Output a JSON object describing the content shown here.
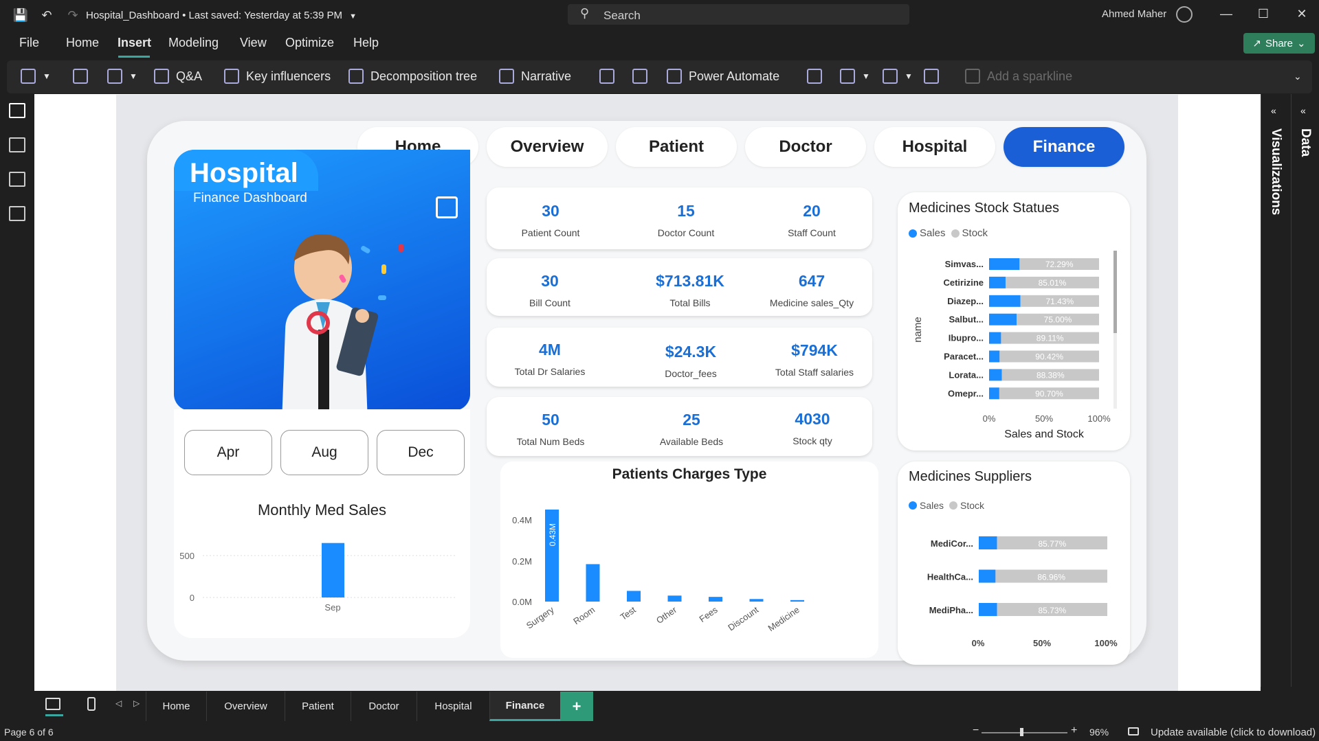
{
  "titlebar": {
    "file_name": "Hospital_Dashboard",
    "saved": "Last saved: Yesterday at 5:39 PM",
    "search_placeholder": "Search",
    "user": "Ahmed Maher"
  },
  "menu": {
    "items": [
      "File",
      "Home",
      "Insert",
      "Modeling",
      "View",
      "Optimize",
      "Help"
    ],
    "active": "Insert",
    "share_label": "Share"
  },
  "ribbon": {
    "qa": "Q&A",
    "key_influencers": "Key influencers",
    "decomposition_tree": "Decomposition tree",
    "narrative": "Narrative",
    "power_automate": "Power Automate",
    "add_sparkline": "Add a sparkline"
  },
  "panes": {
    "visualizations": "Visualizations",
    "data": "Data"
  },
  "dashboard": {
    "nav": [
      "Home",
      "Overview",
      "Patient",
      "Doctor",
      "Hospital",
      "Finance"
    ],
    "nav_active": "Finance",
    "hero_title": "Hospital",
    "hero_subtitle": "Finance Dashboard",
    "months": [
      "Apr",
      "Aug",
      "Dec"
    ],
    "kpis": [
      {
        "value": "30",
        "label": "Patient Count"
      },
      {
        "value": "15",
        "label": "Doctor Count"
      },
      {
        "value": "20",
        "label": "Staff Count"
      },
      {
        "value": "30",
        "label": "Bill Count"
      },
      {
        "value": "$713.81K",
        "label": "Total Bills"
      },
      {
        "value": "647",
        "label": "Medicine sales_Qty"
      },
      {
        "value": "4M",
        "label": "Total Dr Salaries"
      },
      {
        "value": "$24.3K",
        "label": "Doctor_fees"
      },
      {
        "value": "$794K",
        "label": "Total Staff salaries"
      },
      {
        "value": "50",
        "label": "Total Num Beds"
      },
      {
        "value": "25",
        "label": "Available Beds"
      },
      {
        "value": "4030",
        "label": "Stock qty"
      }
    ]
  },
  "colors": {
    "accent": "#1a8cff",
    "nav_active": "#1a5fd6",
    "stock": "#c8c8c8",
    "kpi_value": "#1a6fd6"
  },
  "chart_data": [
    {
      "type": "bar",
      "title": "Monthly Med Sales",
      "categories": [
        "Sep"
      ],
      "values": [
        650
      ],
      "yticks": [
        "0",
        "500"
      ],
      "ylim": [
        0,
        700
      ]
    },
    {
      "type": "bar",
      "title": "Patients Charges Type",
      "categories": [
        "Surgery",
        "Room",
        "Test",
        "Other",
        "Fees",
        "Discount",
        "Medicine"
      ],
      "values": [
        0.43,
        0.175,
        0.05,
        0.028,
        0.022,
        0.012,
        0.007
      ],
      "data_labels": [
        "0.43M",
        "",
        "",
        "",
        "",
        "",
        ""
      ],
      "yticks": [
        "0.0M",
        "0.2M",
        "0.4M"
      ],
      "ylim": [
        0,
        0.43
      ]
    },
    {
      "type": "bar",
      "orientation": "horizontal",
      "title": "Medicines Stock Statues",
      "legend": [
        "Sales",
        "Stock"
      ],
      "ylabel": "name",
      "xlabel": "Sales and Stock",
      "xticks": [
        "0%",
        "50%",
        "100%"
      ],
      "categories": [
        "Simvas...",
        "Cetirizine",
        "Diazep...",
        "Salbut...",
        "Ibupro...",
        "Paracet...",
        "Lorata...",
        "Omepr..."
      ],
      "sales_share": [
        27.71,
        14.99,
        28.57,
        25.0,
        10.89,
        9.58,
        11.62,
        9.3
      ],
      "stock_labels": [
        "72.29%",
        "85.01%",
        "71.43%",
        "75.00%",
        "89.11%",
        "90.42%",
        "88.38%",
        "90.70%"
      ]
    },
    {
      "type": "bar",
      "orientation": "horizontal",
      "title": "Medicines Suppliers",
      "legend": [
        "Sales",
        "Stock"
      ],
      "xticks": [
        "0%",
        "50%",
        "100%"
      ],
      "categories": [
        "MediCor...",
        "HealthCa...",
        "MediPha..."
      ],
      "sales_share": [
        14.23,
        13.04,
        14.27
      ],
      "stock_labels": [
        "85.77%",
        "86.96%",
        "85.73%"
      ]
    }
  ],
  "tabs": {
    "items": [
      "Home",
      "Overview",
      "Patient",
      "Doctor",
      "Hospital",
      "Finance"
    ],
    "active": "Finance",
    "add": "+"
  },
  "status": {
    "page": "Page 6 of 6",
    "zoom": "96%",
    "update": "Update available (click to download)"
  }
}
